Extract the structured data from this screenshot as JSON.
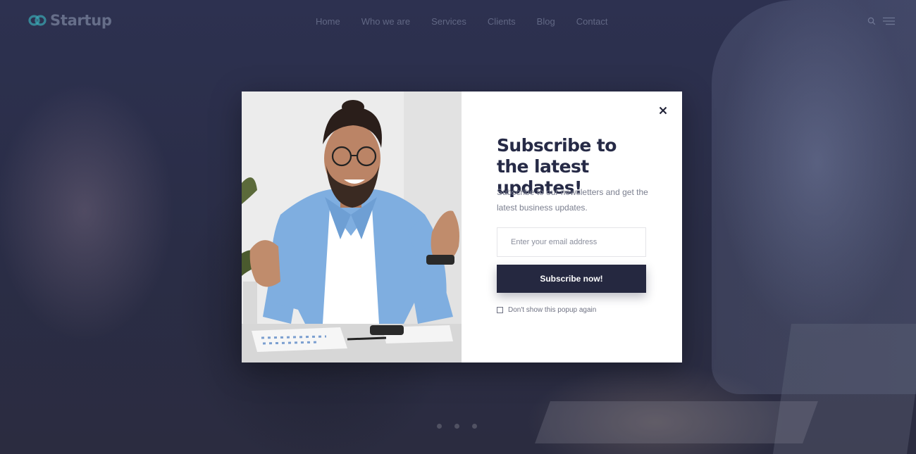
{
  "brand": {
    "name": "Startup",
    "logo_icon": "infinity-link-icon",
    "accent_color": "#3fc6d3"
  },
  "nav": {
    "items": [
      {
        "label": "Home"
      },
      {
        "label": "Who we are"
      },
      {
        "label": "Services"
      },
      {
        "label": "Clients"
      },
      {
        "label": "Blog"
      },
      {
        "label": "Contact"
      }
    ]
  },
  "header_icons": [
    "search-icon",
    "menu-icon"
  ],
  "popup": {
    "title": "Subscribe to the latest updates!",
    "description": "Subscribe to our newsletters and get the latest business updates.",
    "email_placeholder": "Enter your email address",
    "email_value": "",
    "button_label": "Subscribe now!",
    "checkbox_label": "Don't show this popup again",
    "checkbox_checked": false,
    "close_icon": "close-icon",
    "button_color": "#252840",
    "title_color": "#262a46"
  },
  "slider": {
    "dots": 3,
    "active": 0
  }
}
